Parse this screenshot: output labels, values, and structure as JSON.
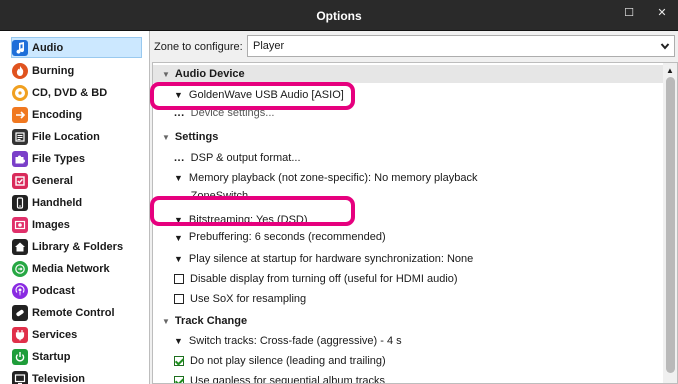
{
  "window": {
    "title": "Options",
    "max_glyph": "☐",
    "close_glyph": "✕"
  },
  "sidebar": {
    "items": [
      {
        "label": "Audio",
        "icon": "music-note-icon",
        "color": "#1e6fd9",
        "selected": true
      },
      {
        "label": "Burning",
        "icon": "fire-icon",
        "color": "#e0531f"
      },
      {
        "label": "CD, DVD & BD",
        "icon": "disc-icon",
        "color": "#f0a020"
      },
      {
        "label": "Encoding",
        "icon": "encoding-icon",
        "color": "#f07820"
      },
      {
        "label": "File Location",
        "icon": "file-location-icon",
        "color": "#333333"
      },
      {
        "label": "File Types",
        "icon": "puzzle-icon",
        "color": "#7a3fc9"
      },
      {
        "label": "General",
        "icon": "general-icon",
        "color": "#d92a5a"
      },
      {
        "label": "Handheld",
        "icon": "handheld-icon",
        "color": "#222222"
      },
      {
        "label": "Images",
        "icon": "images-icon",
        "color": "#e0306a"
      },
      {
        "label": "Library & Folders",
        "icon": "library-icon",
        "color": "#222222"
      },
      {
        "label": "Media Network",
        "icon": "network-icon",
        "color": "#27a844"
      },
      {
        "label": "Podcast",
        "icon": "podcast-icon",
        "color": "#8a2be2"
      },
      {
        "label": "Remote Control",
        "icon": "remote-icon",
        "color": "#222222"
      },
      {
        "label": "Services",
        "icon": "plug-icon",
        "color": "#e0304a"
      },
      {
        "label": "Startup",
        "icon": "power-icon",
        "color": "#1f9d3a"
      },
      {
        "label": "Television",
        "icon": "television-icon",
        "color": "#222222"
      }
    ]
  },
  "zone": {
    "label": "Zone to configure:",
    "value": "Player"
  },
  "sections": {
    "audio_device": {
      "title": "Audio Device",
      "device": "GoldenWave USB Audio [ASIO]",
      "device_settings": "Device settings..."
    },
    "settings": {
      "title": "Settings",
      "dsp": "DSP & output format...",
      "memory": "Memory playback (not zone-specific): No memory playback",
      "zoneswitch": "ZoneSwitch",
      "bitstreaming": "Bitstreaming: Yes (DSD)",
      "prebuffering": "Prebuffering: 6 seconds (recommended)",
      "play_silence": "Play silence at startup for hardware synchronization: None",
      "disable_display": "Disable display from turning off (useful for HDMI audio)",
      "use_sox": "Use SoX for resampling"
    },
    "track_change": {
      "title": "Track Change",
      "switch_tracks": "Switch tracks: Cross-fade (aggressive) - 4 s",
      "no_silence": "Do not play silence (leading and trailing)",
      "gapless": "Use gapless for sequential album tracks",
      "partial": "Use ... for ... track ..."
    }
  },
  "glyphs": {
    "expanded": "▼",
    "chevron": "▾",
    "dots": "...",
    "tri_down": "▼",
    "scroll_up": "▲"
  }
}
